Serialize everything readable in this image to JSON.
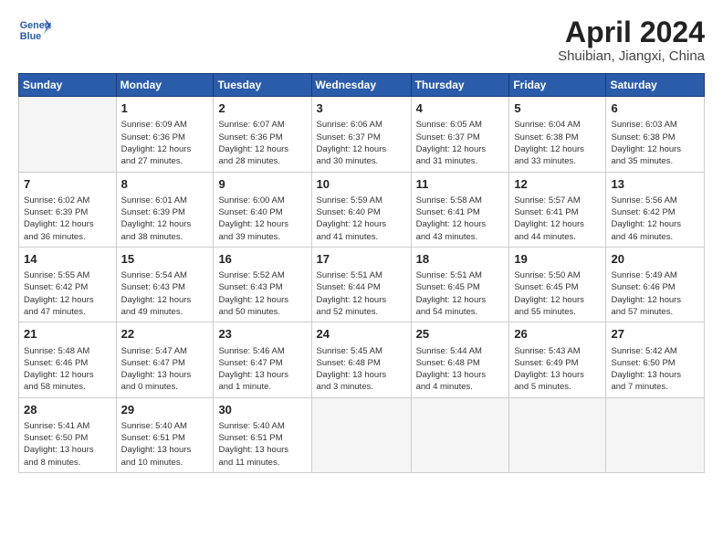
{
  "logo": {
    "line1": "General",
    "line2": "Blue"
  },
  "title": "April 2024",
  "subtitle": "Shuibian, Jiangxi, China",
  "weekdays": [
    "Sunday",
    "Monday",
    "Tuesday",
    "Wednesday",
    "Thursday",
    "Friday",
    "Saturday"
  ],
  "weeks": [
    [
      {
        "num": "",
        "info": ""
      },
      {
        "num": "1",
        "info": "Sunrise: 6:09 AM\nSunset: 6:36 PM\nDaylight: 12 hours\nand 27 minutes."
      },
      {
        "num": "2",
        "info": "Sunrise: 6:07 AM\nSunset: 6:36 PM\nDaylight: 12 hours\nand 28 minutes."
      },
      {
        "num": "3",
        "info": "Sunrise: 6:06 AM\nSunset: 6:37 PM\nDaylight: 12 hours\nand 30 minutes."
      },
      {
        "num": "4",
        "info": "Sunrise: 6:05 AM\nSunset: 6:37 PM\nDaylight: 12 hours\nand 31 minutes."
      },
      {
        "num": "5",
        "info": "Sunrise: 6:04 AM\nSunset: 6:38 PM\nDaylight: 12 hours\nand 33 minutes."
      },
      {
        "num": "6",
        "info": "Sunrise: 6:03 AM\nSunset: 6:38 PM\nDaylight: 12 hours\nand 35 minutes."
      }
    ],
    [
      {
        "num": "7",
        "info": "Sunrise: 6:02 AM\nSunset: 6:39 PM\nDaylight: 12 hours\nand 36 minutes."
      },
      {
        "num": "8",
        "info": "Sunrise: 6:01 AM\nSunset: 6:39 PM\nDaylight: 12 hours\nand 38 minutes."
      },
      {
        "num": "9",
        "info": "Sunrise: 6:00 AM\nSunset: 6:40 PM\nDaylight: 12 hours\nand 39 minutes."
      },
      {
        "num": "10",
        "info": "Sunrise: 5:59 AM\nSunset: 6:40 PM\nDaylight: 12 hours\nand 41 minutes."
      },
      {
        "num": "11",
        "info": "Sunrise: 5:58 AM\nSunset: 6:41 PM\nDaylight: 12 hours\nand 43 minutes."
      },
      {
        "num": "12",
        "info": "Sunrise: 5:57 AM\nSunset: 6:41 PM\nDaylight: 12 hours\nand 44 minutes."
      },
      {
        "num": "13",
        "info": "Sunrise: 5:56 AM\nSunset: 6:42 PM\nDaylight: 12 hours\nand 46 minutes."
      }
    ],
    [
      {
        "num": "14",
        "info": "Sunrise: 5:55 AM\nSunset: 6:42 PM\nDaylight: 12 hours\nand 47 minutes."
      },
      {
        "num": "15",
        "info": "Sunrise: 5:54 AM\nSunset: 6:43 PM\nDaylight: 12 hours\nand 49 minutes."
      },
      {
        "num": "16",
        "info": "Sunrise: 5:52 AM\nSunset: 6:43 PM\nDaylight: 12 hours\nand 50 minutes."
      },
      {
        "num": "17",
        "info": "Sunrise: 5:51 AM\nSunset: 6:44 PM\nDaylight: 12 hours\nand 52 minutes."
      },
      {
        "num": "18",
        "info": "Sunrise: 5:51 AM\nSunset: 6:45 PM\nDaylight: 12 hours\nand 54 minutes."
      },
      {
        "num": "19",
        "info": "Sunrise: 5:50 AM\nSunset: 6:45 PM\nDaylight: 12 hours\nand 55 minutes."
      },
      {
        "num": "20",
        "info": "Sunrise: 5:49 AM\nSunset: 6:46 PM\nDaylight: 12 hours\nand 57 minutes."
      }
    ],
    [
      {
        "num": "21",
        "info": "Sunrise: 5:48 AM\nSunset: 6:46 PM\nDaylight: 12 hours\nand 58 minutes."
      },
      {
        "num": "22",
        "info": "Sunrise: 5:47 AM\nSunset: 6:47 PM\nDaylight: 13 hours\nand 0 minutes."
      },
      {
        "num": "23",
        "info": "Sunrise: 5:46 AM\nSunset: 6:47 PM\nDaylight: 13 hours\nand 1 minute."
      },
      {
        "num": "24",
        "info": "Sunrise: 5:45 AM\nSunset: 6:48 PM\nDaylight: 13 hours\nand 3 minutes."
      },
      {
        "num": "25",
        "info": "Sunrise: 5:44 AM\nSunset: 6:48 PM\nDaylight: 13 hours\nand 4 minutes."
      },
      {
        "num": "26",
        "info": "Sunrise: 5:43 AM\nSunset: 6:49 PM\nDaylight: 13 hours\nand 5 minutes."
      },
      {
        "num": "27",
        "info": "Sunrise: 5:42 AM\nSunset: 6:50 PM\nDaylight: 13 hours\nand 7 minutes."
      }
    ],
    [
      {
        "num": "28",
        "info": "Sunrise: 5:41 AM\nSunset: 6:50 PM\nDaylight: 13 hours\nand 8 minutes."
      },
      {
        "num": "29",
        "info": "Sunrise: 5:40 AM\nSunset: 6:51 PM\nDaylight: 13 hours\nand 10 minutes."
      },
      {
        "num": "30",
        "info": "Sunrise: 5:40 AM\nSunset: 6:51 PM\nDaylight: 13 hours\nand 11 minutes."
      },
      {
        "num": "",
        "info": ""
      },
      {
        "num": "",
        "info": ""
      },
      {
        "num": "",
        "info": ""
      },
      {
        "num": "",
        "info": ""
      }
    ]
  ]
}
